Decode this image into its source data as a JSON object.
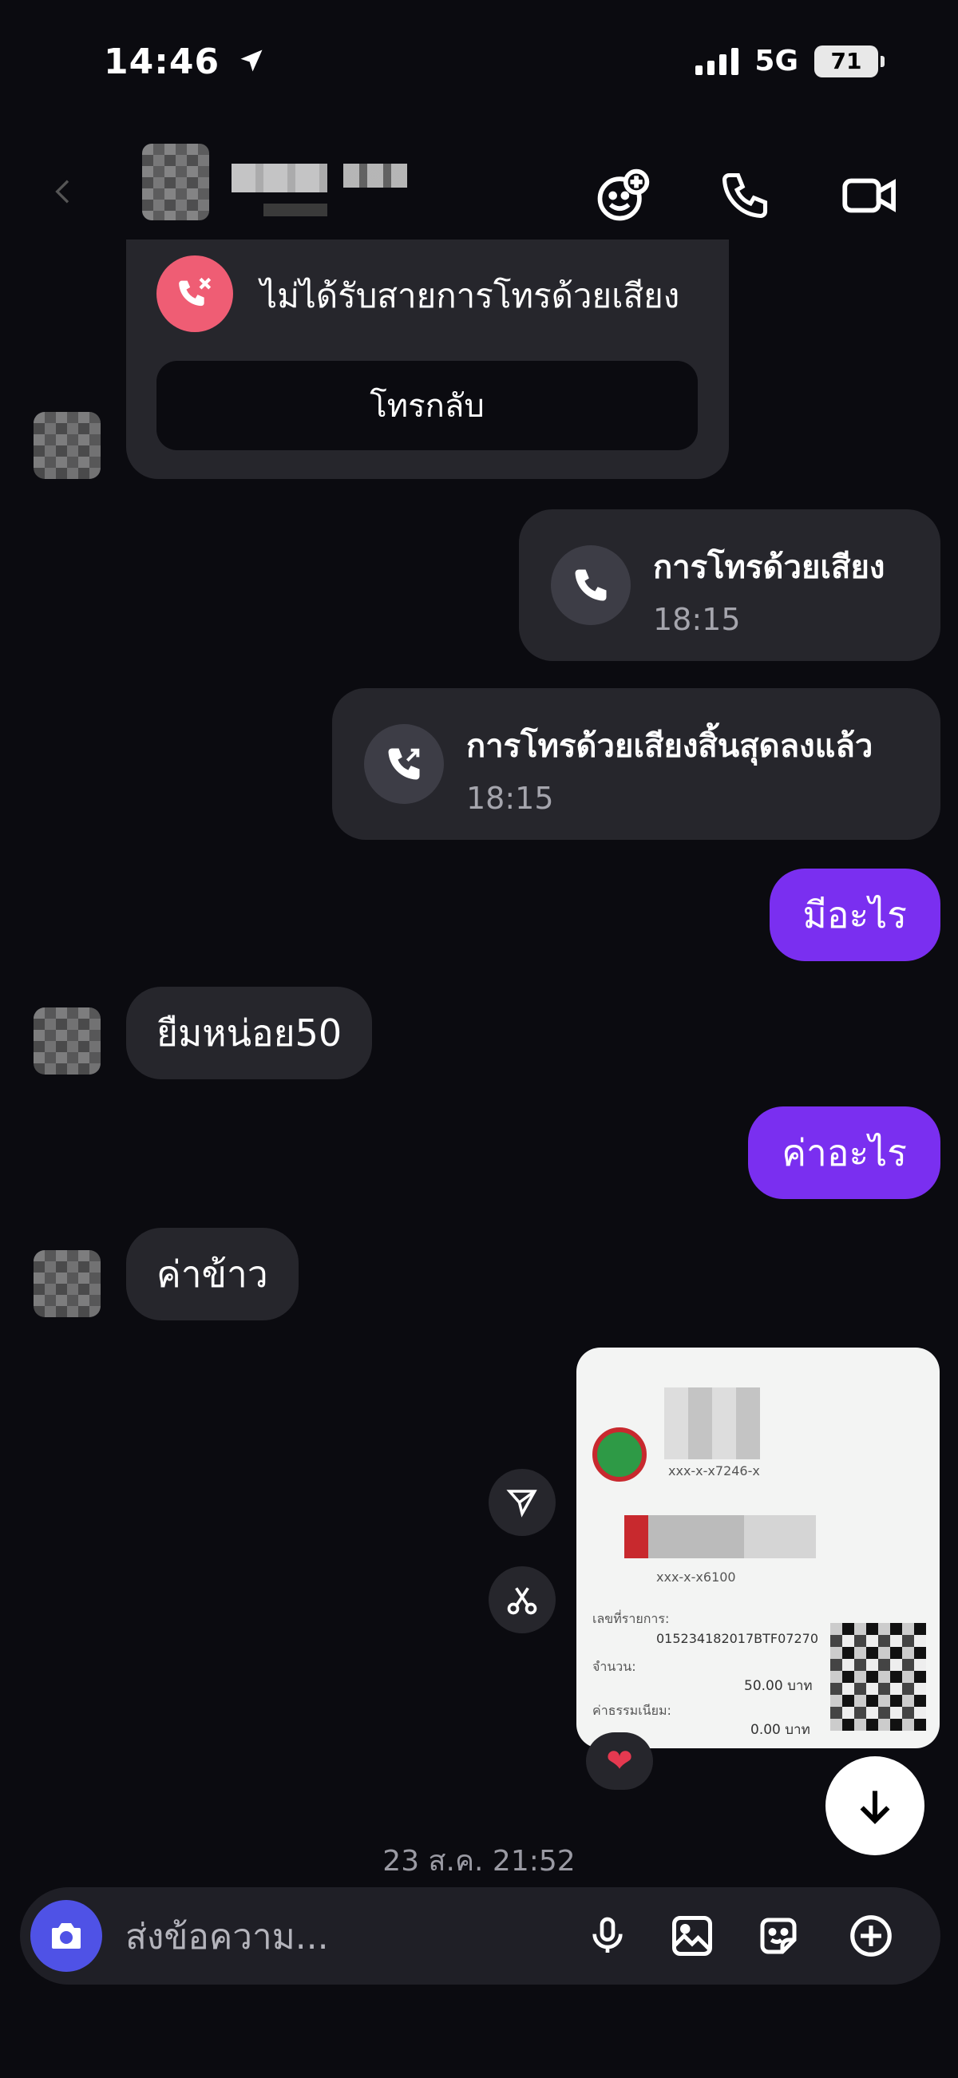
{
  "status_bar": {
    "time": "14:46",
    "network": "5G",
    "battery": "71"
  },
  "messages": {
    "missed_call": {
      "title": "ไม่ได้รับสายการโทรด้วยเสียง",
      "callback_label": "โทรกลับ"
    },
    "voice_call": {
      "title": "การโทรด้วยเสียง",
      "time": "18:15"
    },
    "call_ended": {
      "title": "การโทรด้วยเสียงสิ้นสุดลงแล้ว",
      "time": "18:15"
    },
    "out_1": "มีอะไร",
    "in_1": "ยืมหน่อย50",
    "out_2": "ค่าอะไร",
    "in_2": "ค่าข้าว"
  },
  "receipt": {
    "account_1": "xxx-x-x7246-x",
    "account_2": "xxx-x-x6100",
    "ref_label": "เลขที่รายการ:",
    "ref_value": "015234182017BTF07270",
    "amount_label": "จำนวน:",
    "amount_value": "50.00 บาท",
    "fee_label": "ค่าธรรมเนียม:",
    "fee_value": "0.00 บาท"
  },
  "reaction": "❤",
  "date_stamp": "23 ส.ค. 21:52",
  "composer": {
    "placeholder": "ส่งข้อความ..."
  },
  "icons": {
    "location": "location-arrow-icon",
    "add_person": "add-person-icon",
    "phone": "phone-icon",
    "video": "video-icon",
    "camera": "camera-icon",
    "mic": "microphone-icon",
    "gallery": "gallery-icon",
    "sticker": "sticker-icon",
    "plus": "plus-icon",
    "forward": "forward-icon",
    "scissors": "scissors-icon",
    "arrow_down": "arrow-down-icon"
  },
  "colors": {
    "background": "#0b0b10",
    "bubble_in": "#26262c",
    "bubble_out": "#7a2ff0",
    "missed_red": "#ef5d74",
    "camera_btn": "#4f52e6"
  }
}
